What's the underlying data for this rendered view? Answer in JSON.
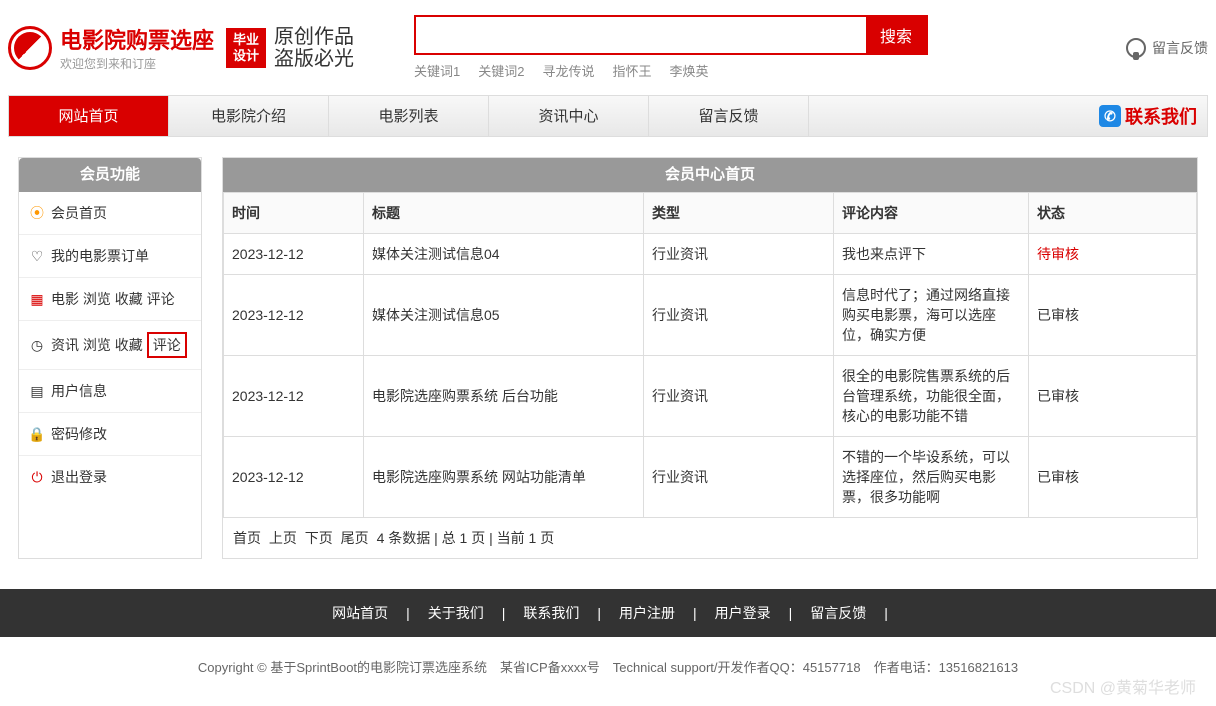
{
  "header": {
    "logo_title": "电影院购票选座",
    "logo_sub": "欢迎您到来和订座",
    "badge": "毕业\n设计",
    "calligraphy1": "原创作品",
    "calligraphy2": "盗版必光",
    "search_placeholder": "",
    "search_btn": "搜索",
    "keywords": [
      "关键词1",
      "关键词2",
      "寻龙传说",
      "指怀王",
      "李焕英"
    ],
    "feedback": "留言反馈"
  },
  "nav": {
    "items": [
      "网站首页",
      "电影院介绍",
      "电影列表",
      "资讯中心",
      "留言反馈"
    ],
    "contact": "联系我们"
  },
  "sidebar": {
    "title": "会员功能",
    "items": [
      {
        "label": "会员首页"
      },
      {
        "label": "我的电影票订单"
      },
      {
        "label": "电影 浏览 收藏 评论"
      },
      {
        "label": "资讯 浏览 收藏 ",
        "hl": "评论"
      },
      {
        "label": "用户信息"
      },
      {
        "label": "密码修改"
      },
      {
        "label": "退出登录"
      }
    ]
  },
  "content": {
    "title": "会员中心首页",
    "headers": [
      "时间",
      "标题",
      "类型",
      "评论内容",
      "状态"
    ],
    "rows": [
      {
        "time": "2023-12-12",
        "title": "媒体关注测试信息04",
        "type": "行业资讯",
        "content": "我也来点评下",
        "status": "待审核",
        "pending": true
      },
      {
        "time": "2023-12-12",
        "title": "媒体关注测试信息05",
        "type": "行业资讯",
        "content": "信息时代了；通过网络直接购买电影票，海可以选座位，确实方便",
        "status": "已审核"
      },
      {
        "time": "2023-12-12",
        "title": "电影院选座购票系统 后台功能",
        "type": "行业资讯",
        "content": "很全的电影院售票系统的后台管理系统，功能很全面，核心的电影功能不错",
        "status": "已审核"
      },
      {
        "time": "2023-12-12",
        "title": "电影院选座购票系统 网站功能清单",
        "type": "行业资讯",
        "content": "不错的一个毕设系统，可以选择座位，然后购买电影票，很多功能啊",
        "status": "已审核"
      }
    ],
    "pagination": {
      "first": "首页",
      "prev": "上页",
      "next": "下页",
      "last": "尾页",
      "info": "4 条数据 | 总 1 页 | 当前 1 页"
    }
  },
  "footer": {
    "links": [
      "网站首页",
      "关于我们",
      "联系我们",
      "用户注册",
      "用户登录",
      "留言反馈"
    ],
    "copyright": "Copyright © 基于SprintBoot的电影院订票选座系统　某省ICP备xxxx号　Technical support/开发作者QQ：45157718　作者电话：13516821613"
  },
  "watermark": "CSDN @黄菊华老师"
}
